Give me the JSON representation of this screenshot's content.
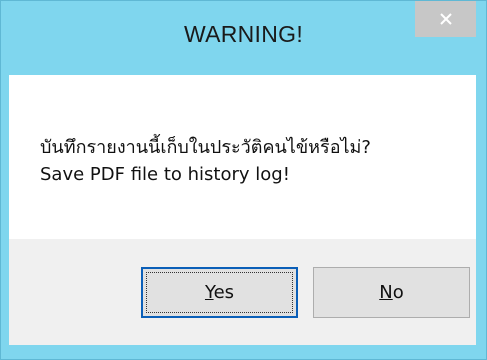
{
  "dialog": {
    "title": "WARNING!",
    "message_line_1": "บันทึกรายงานนี้เก็บในประวัติคนไข้หรือไม่?",
    "message_line_2": "Save PDF file to history log!"
  },
  "buttons": {
    "yes": {
      "mnemonic": "Y",
      "rest": "es",
      "focused": true
    },
    "no": {
      "mnemonic": "N",
      "rest": "o",
      "focused": false
    }
  },
  "colors": {
    "frame": "#7fd6ee",
    "close_button": "#c7c7c7",
    "footer": "#f0f0f0",
    "button_face": "#e1e1e1",
    "focus_border": "#0b5fb8"
  },
  "icons": {
    "close": "close-icon"
  }
}
